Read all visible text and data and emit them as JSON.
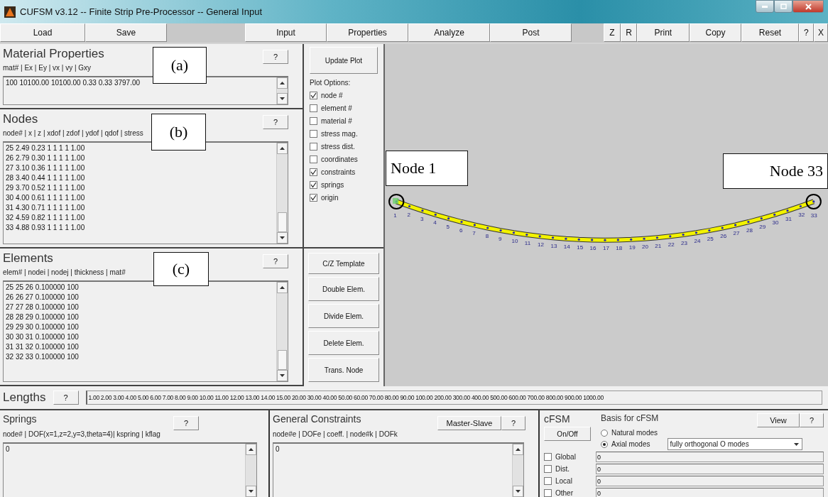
{
  "window": {
    "title": "CUFSM v3.12 -- Finite Strip Pre-Processor -- General Input"
  },
  "toolbar": {
    "left": [
      "Load",
      "Save"
    ],
    "middle": [
      "Input",
      "Properties",
      "Analyze",
      "Post"
    ],
    "right": [
      "Z",
      "R",
      "Print",
      "Copy",
      "Reset",
      "?",
      "X"
    ]
  },
  "material": {
    "title": "Material Properties",
    "help": "?",
    "columns": "mat# | Ex | Ey | vx | vy | Gxy",
    "rows": [
      "100 10100.00 10100.00 0.33 0.33 3797.00"
    ]
  },
  "nodes": {
    "title": "Nodes",
    "help": "?",
    "columns": "node# | x | z | xdof | zdof | ydof | qdof | stress",
    "rows": [
      "25 2.49 0.23 1 1 1 1 1.00",
      "26 2.79 0.30 1 1 1 1 1.00",
      "27 3.10 0.36 1 1 1 1 1.00",
      "28 3.40 0.44 1 1 1 1 1.00",
      "29 3.70 0.52 1 1 1 1 1.00",
      "30 4.00 0.61 1 1 1 1 1.00",
      "31 4.30 0.71 1 1 1 1 1.00",
      "32 4.59 0.82 1 1 1 1 1.00",
      "33 4.88 0.93 1 1 1 1 1.00"
    ]
  },
  "elements": {
    "title": "Elements",
    "help": "?",
    "columns": "elem# | nodei | nodej | thickness | mat#",
    "rows": [
      "25 25 26 0.100000 100",
      "26 26 27 0.100000 100",
      "27 27 28 0.100000 100",
      "28 28 29 0.100000 100",
      "29 29 30 0.100000 100",
      "30 30 31 0.100000 100",
      "31 31 32 0.100000 100",
      "32 32 33 0.100000 100"
    ]
  },
  "plot": {
    "update_button": "Update Plot",
    "options_title": "Plot Options:",
    "options": [
      {
        "label": "node #",
        "checked": true
      },
      {
        "label": "element #",
        "checked": false
      },
      {
        "label": "material #",
        "checked": false
      },
      {
        "label": "stress mag.",
        "checked": false
      },
      {
        "label": "stress dist.",
        "checked": false
      },
      {
        "label": "coordinates",
        "checked": false
      },
      {
        "label": "constraints",
        "checked": true
      },
      {
        "label": "springs",
        "checked": true
      },
      {
        "label": "origin",
        "checked": true
      }
    ],
    "tools": [
      "C/Z Template",
      "Double Elem.",
      "Divide Elem.",
      "Delete Elem.",
      "Trans. Node"
    ]
  },
  "canvas": {
    "node_labels": [
      "1",
      "2",
      "3",
      "4",
      "5",
      "6",
      "7",
      "8",
      "9",
      "10",
      "11",
      "12",
      "13",
      "14",
      "15",
      "16",
      "17",
      "18",
      "19",
      "20",
      "21",
      "22",
      "23",
      "24",
      "25",
      "26",
      "27",
      "28",
      "29",
      "30",
      "31",
      "32",
      "33"
    ]
  },
  "annotations": [
    {
      "text": "(a)"
    },
    {
      "text": "(b)"
    },
    {
      "text": "(c)"
    },
    {
      "text": "Node 1"
    },
    {
      "text": "Node 33"
    }
  ],
  "lengths": {
    "label": "Lengths",
    "help": "?",
    "value": "1.00 2.00 3.00 4.00 5.00 6.00 7.00 8.00 9.00 10.00 11.00 12.00 13.00 14.00 15.00 20.00 30.00 40.00 50.00 60.00 70.00 80.00 90.00 100.00 200.00 300.00 400.00 500.00 600.00 700.00 800.00 900.00 1000.00"
  },
  "springs": {
    "title": "Springs",
    "help": "?",
    "columns": "node# | DOF(x=1,z=2,y=3,theta=4)| kspring | kflag",
    "value": "0"
  },
  "constraints": {
    "title": "General Constraints",
    "buttons": [
      "Master-Slave",
      "?"
    ],
    "columns": "node#e | DOFe | coeff. | node#k | DOFk",
    "value": "0"
  },
  "cfsm": {
    "title": "cFSM",
    "toggle": "On/Off",
    "basis_title": "Basis for cFSM",
    "buttons": [
      "View",
      "?"
    ],
    "basis": [
      {
        "label": "Natural modes",
        "selected": false
      },
      {
        "label": "Axial modes",
        "selected": true
      }
    ],
    "dropdown": "fully orthogonal O modes",
    "modes": [
      {
        "label": "Global",
        "checked": false,
        "value": "0"
      },
      {
        "label": "Dist.",
        "checked": false,
        "value": "0"
      },
      {
        "label": "Local",
        "checked": false,
        "value": "0"
      },
      {
        "label": "Other",
        "checked": false,
        "value": "0"
      }
    ]
  }
}
